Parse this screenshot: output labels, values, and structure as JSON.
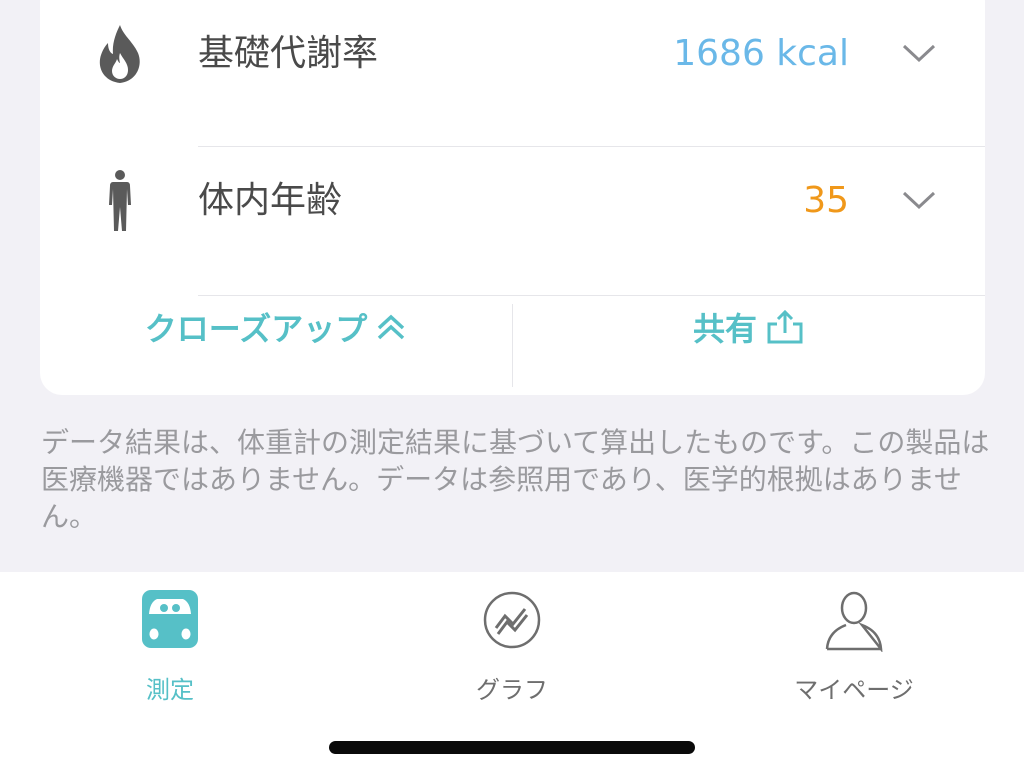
{
  "metrics": [
    {
      "label": "基礎代謝率",
      "value": "1686 kcal",
      "icon": "flame-icon",
      "value_color": "#6ab8e8"
    },
    {
      "label": "体内年齢",
      "value": "35",
      "icon": "body-icon",
      "value_color": "#f0981a"
    }
  ],
  "actions": {
    "close_up_label": "クローズアップ",
    "share_label": "共有"
  },
  "disclaimer": "データ結果は、体重計の測定結果に基づいて算出したものです。この製品は医療機器ではありません。データは参照用であり、医学的根拠はありません。",
  "tabs": [
    {
      "label": "測定",
      "icon": "scale-icon",
      "active": true
    },
    {
      "label": "グラフ",
      "icon": "trend-chart-icon",
      "active": false
    },
    {
      "label": "マイページ",
      "icon": "profile-icon",
      "active": false
    }
  ],
  "colors": {
    "accent": "#56c0c7",
    "background": "#f2f1f6"
  }
}
